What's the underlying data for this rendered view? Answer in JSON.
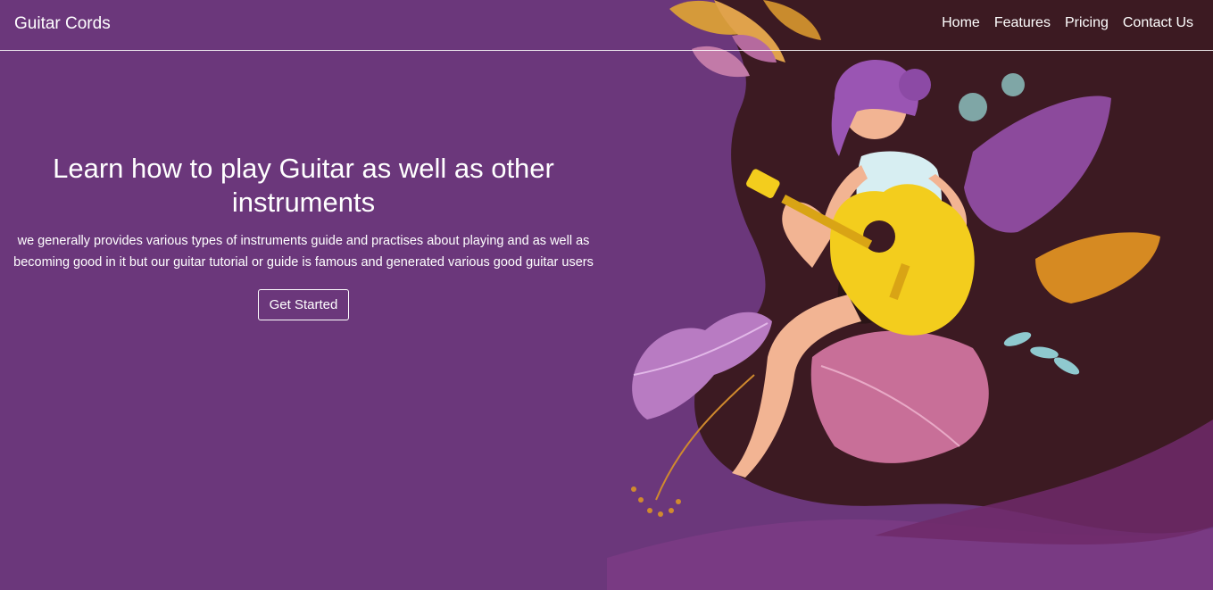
{
  "navbar": {
    "brand": "Guitar Cords",
    "links": [
      "Home",
      "Features",
      "Pricing",
      "Contact Us"
    ]
  },
  "hero": {
    "title": "Learn how to play Guitar as well as other instruments",
    "description": "we generally provides various types of instruments guide and practises about playing and as well as becoming good in it but our guitar tutorial or guide is famous and generated various good guitar users",
    "cta_label": "Get Started"
  },
  "colors": {
    "background": "#6b377b",
    "illustration_dark": "#3c1a22",
    "guitar_yellow": "#f3cd1d",
    "text": "#ffffff"
  }
}
